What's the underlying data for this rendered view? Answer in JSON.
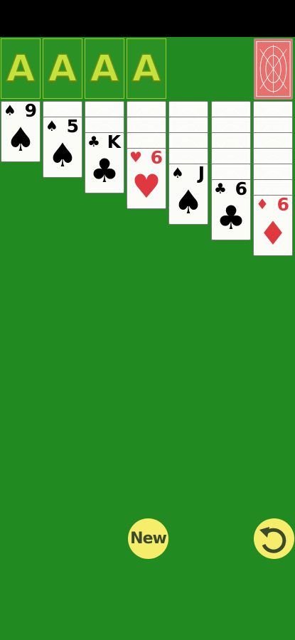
{
  "foundations": [
    {
      "label": "A"
    },
    {
      "label": "A"
    },
    {
      "label": "A"
    },
    {
      "label": "A"
    }
  ],
  "stock": {
    "icon": "card-back"
  },
  "tableau": [
    {
      "face_down": 0,
      "card": {
        "rank": "9",
        "suit": "♠",
        "color": "black"
      }
    },
    {
      "face_down": 1,
      "card": {
        "rank": "5",
        "suit": "♠",
        "color": "black"
      }
    },
    {
      "face_down": 2,
      "card": {
        "rank": "K",
        "suit": "♣",
        "color": "black"
      }
    },
    {
      "face_down": 3,
      "card": {
        "rank": "6",
        "suit": "♥",
        "color": "red"
      }
    },
    {
      "face_down": 4,
      "card": {
        "rank": "J",
        "suit": "♠",
        "color": "black"
      }
    },
    {
      "face_down": 5,
      "card": {
        "rank": "6",
        "suit": "♣",
        "color": "black"
      }
    },
    {
      "face_down": 6,
      "card": {
        "rank": "6",
        "suit": "♦",
        "color": "red"
      }
    }
  ],
  "buttons": {
    "new_label": "New",
    "undo_icon": "undo-icon"
  },
  "colors": {
    "felt": "#218a21",
    "card_back": "#e8706c",
    "button": "#f6ee6a",
    "foundation_letter": "#c4e13c"
  }
}
